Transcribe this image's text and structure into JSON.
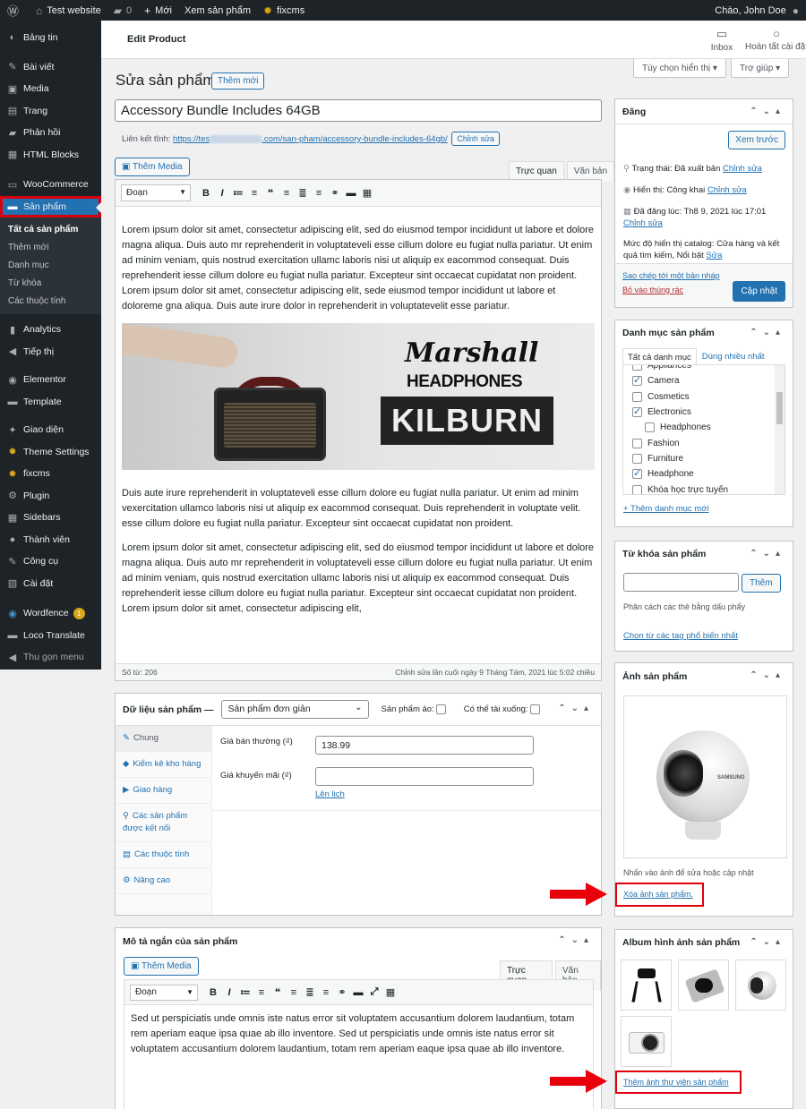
{
  "adminbar": {
    "site": "Test website",
    "comments": "0",
    "new": "Mới",
    "view": "Xem sản phẩm",
    "plugin": "fixcms",
    "greeting": "Chào, John Doe"
  },
  "menu": {
    "items": [
      {
        "label": "Bảng tin",
        "icon": "dashboard-icon",
        "glyph": "◐"
      },
      {
        "label": "Bài viết",
        "icon": "pin-icon",
        "glyph": "✎"
      },
      {
        "label": "Media",
        "icon": "media-icon",
        "glyph": "▣"
      },
      {
        "label": "Trang",
        "icon": "page-icon",
        "glyph": "▤"
      },
      {
        "label": "Phản hồi",
        "icon": "comment-icon",
        "glyph": "▰"
      },
      {
        "label": "HTML Blocks",
        "icon": "blocks-icon",
        "glyph": "▦"
      }
    ],
    "woo": {
      "label": "WooCommerce"
    },
    "products": {
      "label": "Sản phẩm"
    },
    "sub": [
      "Tất cả sản phẩm",
      "Thêm mới",
      "Danh mục",
      "Từ khóa",
      "Các thuộc tính"
    ],
    "items2": [
      {
        "label": "Analytics",
        "glyph": "▮"
      },
      {
        "label": "Tiếp thị",
        "glyph": "◀"
      },
      {
        "label": "Elementor",
        "glyph": "◉"
      },
      {
        "label": "Template",
        "glyph": "▬"
      },
      {
        "label": "Giao diện",
        "glyph": "✦"
      },
      {
        "label": "Theme Settings",
        "glyph": "✹"
      },
      {
        "label": "fixcms",
        "glyph": "✹"
      },
      {
        "label": "Plugin",
        "glyph": "⚙"
      },
      {
        "label": "Sidebars",
        "glyph": "▦"
      },
      {
        "label": "Thành viên",
        "glyph": "●"
      },
      {
        "label": "Công cụ",
        "glyph": "✎"
      },
      {
        "label": "Cài đặt",
        "glyph": "▧"
      }
    ],
    "wordfence": {
      "label": "Wordfence",
      "badge": "1"
    },
    "loco": {
      "label": "Loco Translate"
    },
    "collapse": {
      "label": "Thu gọn menu"
    }
  },
  "topbar": {
    "title": "Edit Product",
    "inbox": "Inbox",
    "done": "Hoàn tất cài đặt"
  },
  "screen_options": "Tùy chọn hiển thị ▾",
  "help": "Trợ giúp ▾",
  "page": {
    "heading": "Sửa sản phẩm",
    "add_new": "Thêm mới"
  },
  "product": {
    "title": "Accessory Bundle Includes 64GB",
    "permalink_label": "Liên kết tĩnh:",
    "permalink_a": "https://tes",
    "permalink_b": ".com/san-pham/",
    "permalink_slug": "accessory-bundle-includes-64gb",
    "permalink_end": "/",
    "edit_btn": "Chỉnh sửa"
  },
  "editor": {
    "add_media": "Thêm Media",
    "tab_visual": "Trực quan",
    "tab_text": "Văn bản",
    "format": "Đoạn",
    "p1": "Lorem ipsum dolor sit amet, consectetur adipiscing elit, sed do eiusmod tempor incididunt ut labore et dolore magna aliqua. Duis auto mr reprehenderit in voluptateveli esse cillum dolore eu fugiat nulla pariatur. Ut enim ad minim veniam, quis nostrud exercitation ullamc laboris nisi ut aliquip ex eacommod consequat. Duis reprehenderit iesse cillum dolore eu fugiat nulla pariatur. Excepteur sint occaecat cupidatat non proident. Lorem ipsum dolor sit amet, consectetur adipiscing elit, sede eiusmod tempor incididunt ut labore et doloreme gna aliqua. Duis aute irure dolor in reprehenderit in voluptatevelit esse pariatur.",
    "banner_brand1": "Marshall",
    "banner_brand2": "HEADPHONES",
    "banner_model": "KILBURN",
    "p2": "Duis aute irure reprehenderit in voluptateveli esse cillum dolore eu fugiat nulla pariatur. Ut enim ad minim vexercitation ullamco laboris nisi ut aliquip ex eacommod consequat. Duis reprehenderit in voluptate velit. esse cillum dolore eu fugiat nulla pariatur. Excepteur sint occaecat cupidatat non proident.",
    "p3": "Lorem ipsum dolor sit amet, consectetur adipiscing elit, sed do eiusmod tempor incididunt ut labore et dolore magna aliqua. Duis auto mr reprehenderit in voluptateveli esse cillum dolore eu fugiat nulla pariatur. Ut enim ad minim veniam, quis nostrud exercitation ullamc laboris nisi ut aliquip ex eacommod consequat. Duis reprehenderit iesse cillum dolore eu fugiat nulla pariatur. Excepteur sint occaecat cupidatat non proident. Lorem ipsum dolor sit amet, consectetur adipiscing elit,",
    "word_count": "Số từ: 206",
    "last_edit": "Chỉnh sửa lần cuối ngày 9 Tháng Tám, 2021 lúc 5:02 chiều"
  },
  "product_data": {
    "label": "Dữ liệu sản phẩm —",
    "type": "Sản phẩm đơn giản",
    "virtual": "Sản phẩm ảo:",
    "downloadable": "Có thể tải xuống:",
    "tabs": [
      {
        "label": "Chung",
        "glyph": "✎"
      },
      {
        "label": "Kiểm kê kho hàng",
        "glyph": "◆"
      },
      {
        "label": "Giao hàng",
        "glyph": "▶"
      },
      {
        "label": "Các sản phẩm được kết nối",
        "glyph": "⚲"
      },
      {
        "label": "Các thuộc tính",
        "glyph": "▤"
      },
      {
        "label": "Nâng cao",
        "glyph": "⚙"
      }
    ],
    "regular_price_label": "Giá bán thường (₫)",
    "regular_price": "138.99",
    "sale_price_label": "Giá khuyến mãi (₫)",
    "sale_price": "",
    "schedule": "Lên lịch"
  },
  "short_desc": {
    "title": "Mô tả ngắn của sản phẩm",
    "add_media": "Thêm Media",
    "tab_visual": "Trực quan",
    "tab_text": "Văn bản",
    "format": "Đoạn",
    "text": "Sed ut perspiciatis unde omnis iste natus error sit voluptatem accusantium dolorem laudantium, totam rem aperiam eaque ipsa quae ab illo inventore. Sed ut perspiciatis unde omnis iste natus error sit voluptatem accusantium dolorem laudantium, totam rem aperiam eaque ipsa quae ab illo inventore."
  },
  "publish": {
    "title": "Đăng",
    "preview": "Xem trước",
    "status_label": "Trạng thái:",
    "status": "Đã xuất bản",
    "status_edit": "Chỉnh sửa",
    "visibility_label": "Hiển thị:",
    "visibility": "Công khai",
    "visibility_edit": "Chỉnh sửa",
    "published_label": "Đã đăng lúc:",
    "published": "Th8 9, 2021 lúc 17:01",
    "published_edit": "Chỉnh sửa",
    "catalog_label": "Mức độ hiển thị catalog:",
    "catalog": "Cửa hàng và kết quả tìm kiếm, Nổi bật",
    "catalog_edit": "Sửa",
    "copy": "Sao chép tới một bản nháp",
    "trash": "Bỏ vào thùng rác",
    "update": "Cập nhật"
  },
  "categories": {
    "title": "Danh mục sản phẩm",
    "tab_all": "Tất cả danh mục",
    "tab_popular": "Dùng nhiều nhất",
    "items": [
      {
        "label": "Appliances",
        "checked": false,
        "child": false
      },
      {
        "label": "Camera",
        "checked": true,
        "child": false
      },
      {
        "label": "Cosmetics",
        "checked": false,
        "child": false
      },
      {
        "label": "Electronics",
        "checked": true,
        "child": false
      },
      {
        "label": "Headphones",
        "checked": false,
        "child": true
      },
      {
        "label": "Fashion",
        "checked": false,
        "child": false
      },
      {
        "label": "Furniture",
        "checked": false,
        "child": false
      },
      {
        "label": "Headphone",
        "checked": true,
        "child": false
      },
      {
        "label": "Khóa học trực tuyến",
        "checked": false,
        "child": false
      }
    ],
    "add": "+ Thêm danh mục mới"
  },
  "tags": {
    "title": "Từ khóa sản phẩm",
    "add": "Thêm",
    "hint": "Phân cách các thẻ bằng dấu phẩy",
    "popular": "Chọn từ các tag phổ biến nhất"
  },
  "image": {
    "title": "Ảnh sản phẩm",
    "brand": "SAMSUNG",
    "hint": "Nhấn vào ảnh để sửa hoặc cập nhật",
    "remove": "Xóa ảnh sản phẩm."
  },
  "gallery": {
    "title": "Album hình ảnh sản phẩm",
    "add": "Thêm ảnh thư viện sản phẩm"
  },
  "colors": {
    "accent": "#2271b1",
    "admin_dark": "#1d2327",
    "highlight": "#e0000b"
  }
}
